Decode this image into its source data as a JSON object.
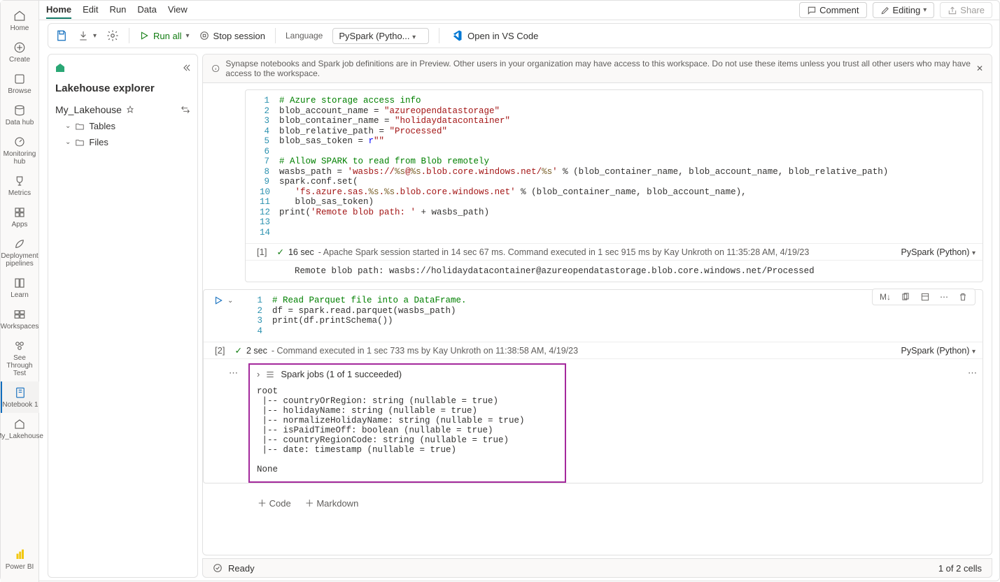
{
  "leftrail": {
    "items": [
      {
        "label": "Home"
      },
      {
        "label": "Create"
      },
      {
        "label": "Browse"
      },
      {
        "label": "Data hub"
      },
      {
        "label": "Monitoring hub"
      },
      {
        "label": "Metrics"
      },
      {
        "label": "Apps"
      },
      {
        "label": "Deployment pipelines"
      },
      {
        "label": "Learn"
      },
      {
        "label": "Workspaces"
      },
      {
        "label": "See Through Test"
      },
      {
        "label": "Notebook 1"
      },
      {
        "label": "My_Lakehouse"
      }
    ],
    "powerbi": "Power BI"
  },
  "topbar": {
    "tabs": [
      "Home",
      "Edit",
      "Run",
      "Data",
      "View"
    ],
    "comment": "Comment",
    "editing": "Editing",
    "share": "Share"
  },
  "toolbar": {
    "runall": "Run all",
    "stop": "Stop session",
    "lang_label": "Language",
    "lang_value": "PySpark (Pytho...",
    "vscode": "Open in VS Code"
  },
  "explorer": {
    "title": "Lakehouse explorer",
    "name": "My_Lakehouse",
    "tables": "Tables",
    "files": "Files"
  },
  "banner": {
    "text": "Synapse notebooks and Spark job definitions are in Preview. Other users in your organization may have access to this workspace. Do not use these items unless you trust all other users who may have access to the workspace."
  },
  "cell1": {
    "idx": "[1]",
    "status_time": "16 sec",
    "status_text": "- Apache Spark session started in 14 sec 67 ms. Command executed in 1 sec 915 ms by Kay Unkroth on 11:35:28 AM, 4/19/23",
    "lang": "PySpark (Python)",
    "output": "Remote blob path: wasbs://holidaydatacontainer@azureopendatastorage.blob.core.windows.net/Processed"
  },
  "cell2": {
    "idx": "[2]",
    "status_time": "2 sec",
    "status_text": "- Command executed in 1 sec 733 ms by Kay Unkroth on 11:38:58 AM, 4/19/23",
    "lang": "PySpark (Python)",
    "toolbar_md": "M↓",
    "spark_hdr": "Spark jobs (1 of 1 succeeded)",
    "schema": "root\n |-- countryOrRegion: string (nullable = true)\n |-- holidayName: string (nullable = true)\n |-- normalizeHolidayName: string (nullable = true)\n |-- isPaidTimeOff: boolean (nullable = true)\n |-- countryRegionCode: string (nullable = true)\n |-- date: timestamp (nullable = true)\n\nNone"
  },
  "addrow": {
    "code": "Code",
    "md": "Markdown"
  },
  "statusbar": {
    "ready": "Ready",
    "cells": "1 of 2 cells"
  }
}
